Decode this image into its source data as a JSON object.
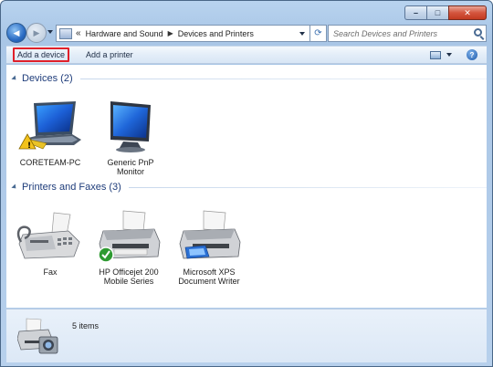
{
  "window": {
    "caption_min": "–",
    "caption_max": "□",
    "caption_close": "✕"
  },
  "nav": {
    "back_glyph": "◀",
    "forward_glyph": "▶",
    "breadcrumb": [
      "Hardware and Sound",
      "Devices and Printers"
    ],
    "overflow_glyph": "«",
    "refresh_glyph": "⟳"
  },
  "search": {
    "placeholder": "Search Devices and Printers"
  },
  "commands": {
    "add_device": "Add a device",
    "add_printer": "Add a printer",
    "help_glyph": "?"
  },
  "groups": [
    {
      "title": "Devices (2)",
      "items": [
        {
          "label": "CORETEAM-PC",
          "icon": "laptop-warning-icon"
        },
        {
          "label": "Generic PnP Monitor",
          "icon": "monitor-icon"
        }
      ]
    },
    {
      "title": "Printers and Faxes (3)",
      "items": [
        {
          "label": "Fax",
          "icon": "fax-icon"
        },
        {
          "label": "HP Officejet 200 Mobile Series",
          "icon": "printer-default-icon"
        },
        {
          "label": "Microsoft XPS Document Writer",
          "icon": "printer-icon"
        }
      ]
    }
  ],
  "status": {
    "count": "5 items"
  },
  "colors": {
    "accent_red": "#e0202a",
    "group_title": "#1e3c7a",
    "default_check": "#2f9a2f"
  }
}
